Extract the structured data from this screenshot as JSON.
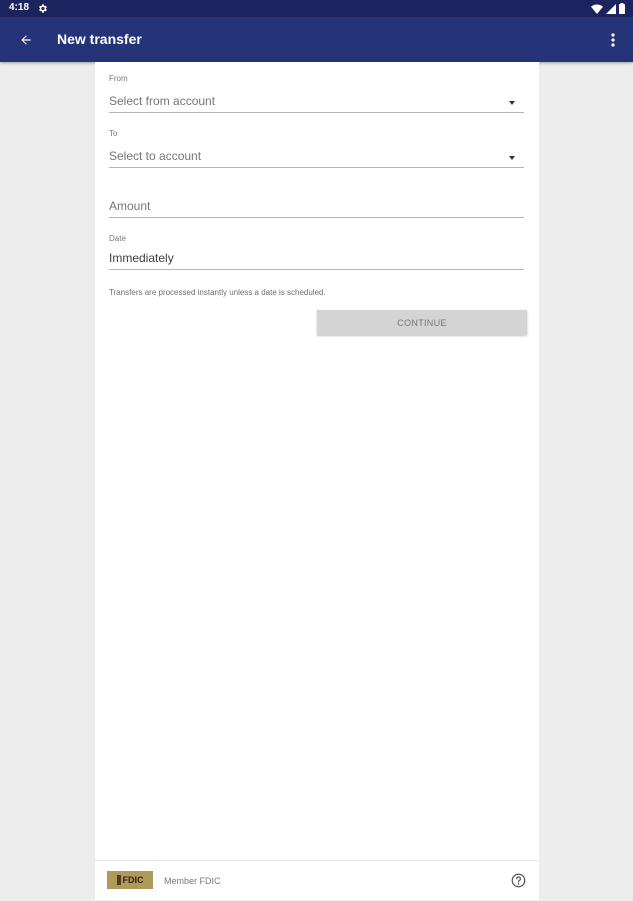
{
  "status_bar": {
    "time": "4:18"
  },
  "app_bar": {
    "title": "New transfer"
  },
  "form": {
    "from": {
      "label": "From",
      "placeholder": "Select from account"
    },
    "to": {
      "label": "To",
      "placeholder": "Select to account"
    },
    "amount": {
      "placeholder": "Amount"
    },
    "date": {
      "label": "Date",
      "value": "Immediately"
    },
    "note": "Transfers are processed instantly unless a date is scheduled.",
    "continue_label": "CONTINUE"
  },
  "footer": {
    "logo_text": "FDIC",
    "member_text": "Member FDIC"
  },
  "colors": {
    "status_bar": "#1c245f",
    "app_bar": "#253379",
    "background": "#ededed",
    "fdic_gold": "#b09a5a"
  }
}
